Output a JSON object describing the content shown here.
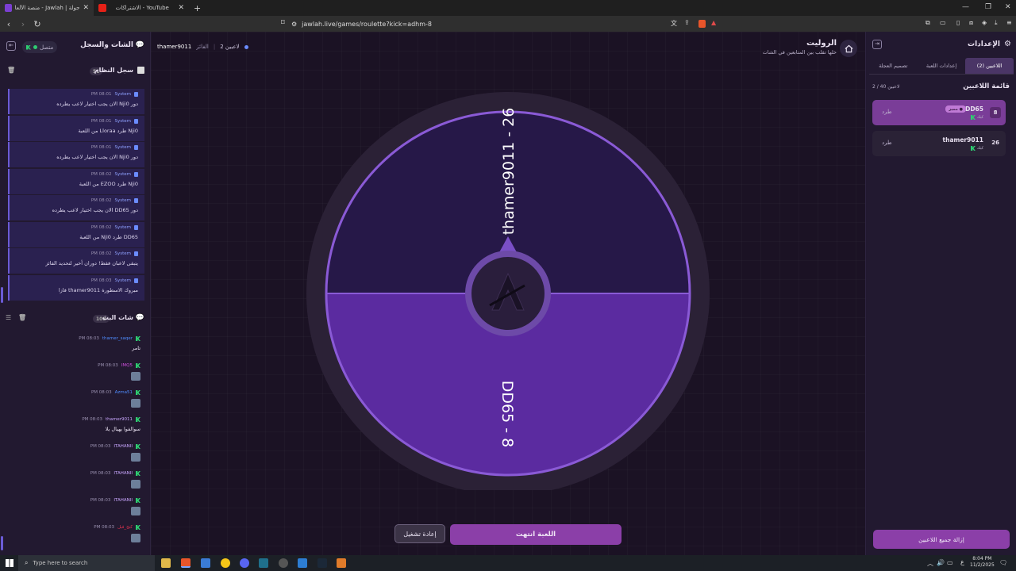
{
  "browser": {
    "tabs": [
      {
        "title": "جولة | Jawlah - منصة الألعاب التفا",
        "active": true
      },
      {
        "title": "الاشتراكات - YouTube",
        "active": false
      }
    ],
    "new_tab": "+",
    "url": "jawlah.live/games/roulette?kick=adhm-8"
  },
  "left_panel": {
    "title": "الشات والسجل",
    "status": "متصل",
    "system_log": {
      "title": "سجل النظام",
      "count": "51",
      "entries": [
        {
          "sender": "System",
          "time": "PM 08:01",
          "message": "دور Nji0 الان يجب اختيار لاعب يطرده"
        },
        {
          "sender": "System",
          "time": "PM 08:01",
          "message": "Nji0 طرد Lloraa من اللعبة"
        },
        {
          "sender": "System",
          "time": "PM 08:01",
          "message": "دور Nji0 الان يجب اختيار لاعب يطرده"
        },
        {
          "sender": "System",
          "time": "PM 08:02",
          "message": "Nji0 طرد EZOO من اللعبة"
        },
        {
          "sender": "System",
          "time": "PM 08:02",
          "message": "دور DD65 الان يجب اختيار لاعب يطرده"
        },
        {
          "sender": "System",
          "time": "PM 08:02",
          "message": "DD65 طرد Nji0 من اللعبة"
        },
        {
          "sender": "System",
          "time": "PM 08:02",
          "message": "يتبقى لاعبان فقط! دوران أخير لتحديد الفائز"
        },
        {
          "sender": "System",
          "time": "PM 08:03",
          "message": "مبروك الاسطورة thamer9011 فازا"
        }
      ]
    },
    "live_chat": {
      "title": "شات البث",
      "count": "108",
      "messages": [
        {
          "user": "thamer_saqer",
          "time": "PM 08:03",
          "text": "تامر",
          "user_color": "#4f8cff",
          "emote": false
        },
        {
          "user": "IMQ5",
          "time": "PM 08:03",
          "text": "",
          "user_color": "#d24fe0",
          "emote": true
        },
        {
          "user": "Azma51",
          "time": "PM 08:03",
          "text": "",
          "user_color": "#4f8cff",
          "emote": true
        },
        {
          "user": "thamer9011",
          "time": "PM 08:03",
          "text": "سوالفوا يهيال يلا",
          "user_color": "#c9a6ff",
          "emote": false
        },
        {
          "user": "ITAHANII",
          "time": "PM 08:03",
          "text": "",
          "user_color": "#c9a6ff",
          "emote": true
        },
        {
          "user": "ITAHANII",
          "time": "PM 08:03",
          "text": "",
          "user_color": "#c9a6ff",
          "emote": true
        },
        {
          "user": "ITAHANII",
          "time": "PM 08:03",
          "text": "",
          "user_color": "#c9a6ff",
          "emote": true
        },
        {
          "user": "كنج_فبل",
          "time": "PM 08:03",
          "text": "",
          "user_color": "#e0334f",
          "emote": true
        }
      ]
    }
  },
  "main": {
    "title": "الروليت",
    "subtitle": "خلها تقلب بين المتابعين في الشات",
    "players_count": "2 لاعبين",
    "winner_label": "الفائز",
    "winner": "thamer9011",
    "wheel": {
      "segments": [
        {
          "label": "thamer9011 - 26",
          "color": "#261848"
        },
        {
          "label": "DD65 - 8",
          "color": "#5b2ba0"
        }
      ],
      "rim_color": "#8a5ad6"
    },
    "restart_button": "إعادة تشغيل",
    "game_over_button": "اللعبة انتهت"
  },
  "right_panel": {
    "title": "الإعدادات",
    "tabs": [
      {
        "label": "اللاعبين (2)",
        "active": true
      },
      {
        "label": "إعدادات اللعبة",
        "active": false
      },
      {
        "label": "تصميم العجلة",
        "active": false
      }
    ],
    "list_title": "قائمة اللاعبين",
    "list_count": "2 / 40 لاعبين",
    "players": [
      {
        "name": "DD65",
        "number": "8",
        "badge": "مميز",
        "sub": "كيك",
        "kick": "طرد",
        "highlight": true
      },
      {
        "name": "thamer9011",
        "number": "26",
        "badge": "",
        "sub": "كيك",
        "kick": "طرد",
        "highlight": false
      }
    ],
    "remove_all_button": "إزالة جميع اللاعبين"
  },
  "taskbar": {
    "search_placeholder": "Type here to search",
    "time": "8:04 PM",
    "date": "11/2/2025",
    "lang": "ع"
  }
}
